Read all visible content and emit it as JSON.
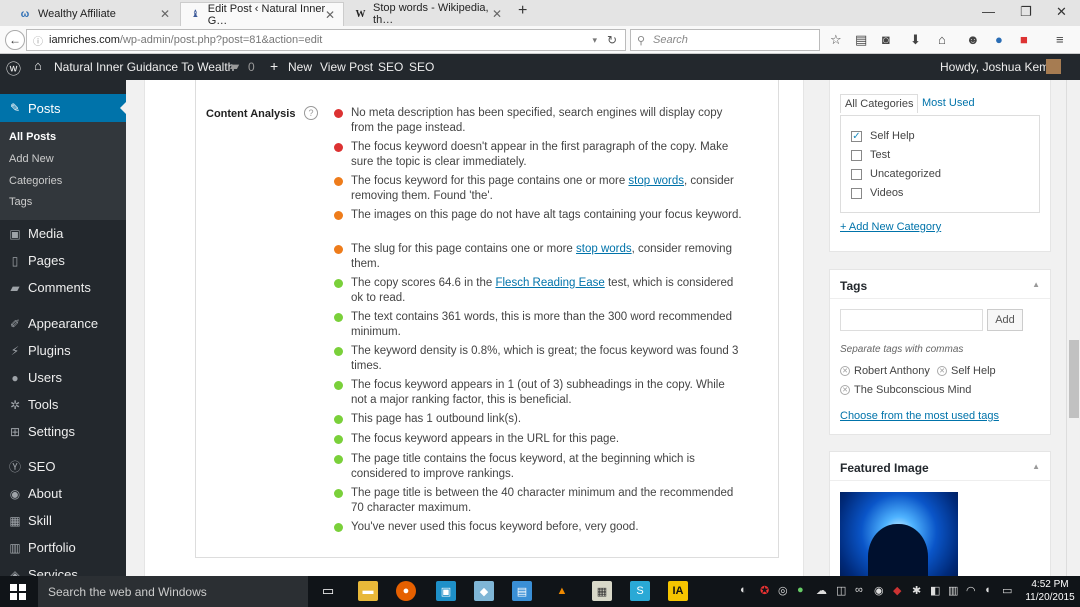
{
  "browser": {
    "tabs": [
      {
        "label": "Wealthy Affiliate",
        "icon": "wealthy-affiliate-icon"
      },
      {
        "label": "Edit Post ‹ Natural Inner G…",
        "icon": "wordpress-icon"
      },
      {
        "label": "Stop words - Wikipedia, th…",
        "icon": "wikipedia-icon",
        "favicon_text": "W"
      }
    ],
    "new_tab": "+",
    "window_controls": {
      "minimize": "—",
      "restore": "❐",
      "close": "✕"
    },
    "url": {
      "domain": "iamriches.com",
      "path": "/wp-admin/post.php?post=81&action=edit"
    },
    "search_placeholder": "Search"
  },
  "adminbar": {
    "site_name": "Natural Inner Guidance To Wealth",
    "comments_count": "0",
    "new_label": "New",
    "view_post": "View Post",
    "seo1": "SEO",
    "seo2": "SEO",
    "howdy": "Howdy, Joshua Kemp"
  },
  "sidebar": {
    "posts": "Posts",
    "sub": [
      "All Posts",
      "Add New",
      "Categories",
      "Tags"
    ],
    "items": [
      {
        "label": "Media",
        "icon": "media-icon"
      },
      {
        "label": "Pages",
        "icon": "pages-icon"
      },
      {
        "label": "Comments",
        "icon": "comments-icon"
      },
      {
        "label": "Appearance",
        "icon": "appearance-icon"
      },
      {
        "label": "Plugins",
        "icon": "plugins-icon"
      },
      {
        "label": "Users",
        "icon": "users-icon"
      },
      {
        "label": "Tools",
        "icon": "tools-icon"
      },
      {
        "label": "Settings",
        "icon": "settings-icon"
      },
      {
        "label": "SEO",
        "icon": "seo-icon"
      },
      {
        "label": "About",
        "icon": "about-icon"
      },
      {
        "label": "Skill",
        "icon": "skill-icon"
      },
      {
        "label": "Portfolio",
        "icon": "portfolio-icon"
      },
      {
        "label": "Services",
        "icon": "services-icon"
      }
    ]
  },
  "content_analysis": {
    "label": "Content Analysis",
    "help": "?",
    "results": [
      {
        "status": "red",
        "pre": "No meta description has been specified, search engines will display copy from the page instead.",
        "link": "",
        "post": ""
      },
      {
        "status": "red",
        "pre": "The focus keyword doesn't appear in the first paragraph of the copy. Make sure the topic is clear immediately.",
        "link": "",
        "post": ""
      },
      {
        "status": "orange",
        "pre": "The focus keyword for this page contains one or more ",
        "link": "stop words",
        "post": ", consider removing them. Found 'the'."
      },
      {
        "status": "orange",
        "pre": "The images on this page do not have alt tags containing your focus keyword.",
        "link": "",
        "post": ""
      },
      {
        "status": "orange",
        "pre": "The slug for this page contains one or more ",
        "link": "stop words",
        "post": ", consider removing them."
      },
      {
        "status": "green",
        "pre": "The copy scores 64.6 in the ",
        "link": "Flesch Reading Ease",
        "post": " test, which is considered ok to read."
      },
      {
        "status": "green",
        "pre": "The text contains 361 words, this is more than the 300 word recommended minimum.",
        "link": "",
        "post": ""
      },
      {
        "status": "green",
        "pre": "The keyword density is 0.8%, which is great; the focus keyword was found 3 times.",
        "link": "",
        "post": ""
      },
      {
        "status": "green",
        "pre": "The focus keyword appears in 1 (out of 3) subheadings in the copy. While not a major ranking factor, this is beneficial.",
        "link": "",
        "post": ""
      },
      {
        "status": "green",
        "pre": "This page has 1 outbound link(s).",
        "link": "",
        "post": ""
      },
      {
        "status": "green",
        "pre": "The focus keyword appears in the URL for this page.",
        "link": "",
        "post": ""
      },
      {
        "status": "green",
        "pre": "The page title contains the focus keyword, at the beginning which is considered to improve rankings.",
        "link": "",
        "post": ""
      },
      {
        "status": "green",
        "pre": "The page title is between the 40 character minimum and the recommended 70 character maximum.",
        "link": "",
        "post": ""
      },
      {
        "status": "green",
        "pre": "You've never used this focus keyword before, very good.",
        "link": "",
        "post": ""
      }
    ]
  },
  "status_colors": {
    "red": "#dc3232",
    "orange": "#ee7c1b",
    "green": "#7ad03a"
  },
  "categories": {
    "tab_all": "All Categories",
    "tab_most": "Most Used",
    "items": [
      {
        "label": "Self Help",
        "checked": true
      },
      {
        "label": "Test",
        "checked": false
      },
      {
        "label": "Uncategorized",
        "checked": false
      },
      {
        "label": "Videos",
        "checked": false
      }
    ],
    "add_new": "+ Add New Category"
  },
  "tags": {
    "title": "Tags",
    "add_button": "Add",
    "hint": "Separate tags with commas",
    "items": [
      "Robert Anthony",
      "Self Help",
      "The Subconscious Mind"
    ],
    "choose": "Choose from the most used tags"
  },
  "featured_image": {
    "title": "Featured Image"
  },
  "taskbar": {
    "search": "Search the web and Windows",
    "time": "4:52 PM",
    "date": "11/20/2015"
  }
}
